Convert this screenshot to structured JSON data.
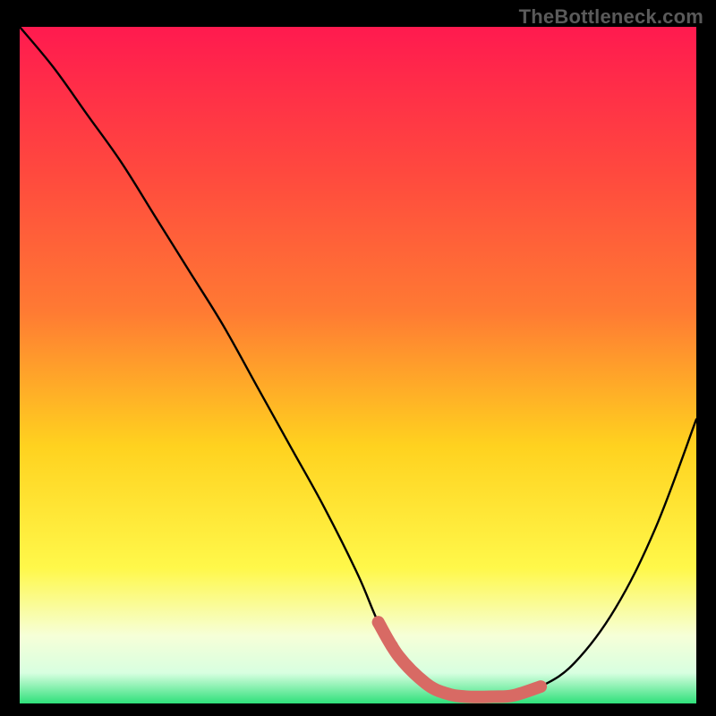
{
  "watermark": "TheBottleneck.com",
  "colors": {
    "frame_bg": "#000000",
    "gradient_top": "#ff1a4f",
    "gradient_mid_upper": "#ff7a33",
    "gradient_mid": "#ffd21f",
    "gradient_mid_lower": "#fff84a",
    "gradient_pale": "#f6ffd8",
    "gradient_bottom": "#2fe07a",
    "curve_stroke": "#000000",
    "highlight_stroke": "#d86a64"
  },
  "chart_data": {
    "type": "line",
    "title": "",
    "xlabel": "",
    "ylabel": "",
    "xlim": [
      0,
      100
    ],
    "ylim": [
      0,
      100
    ],
    "series": [
      {
        "name": "bottleneck-curve",
        "x": [
          0,
          5,
          10,
          15,
          20,
          25,
          30,
          35,
          40,
          45,
          50,
          53,
          56,
          60,
          63,
          66,
          70,
          73,
          77,
          82,
          88,
          94,
          100
        ],
        "y": [
          100,
          94,
          87,
          80,
          72,
          64,
          56,
          47,
          38,
          29,
          19,
          12,
          7,
          3,
          1.5,
          1,
          1,
          1.2,
          2.5,
          6,
          14,
          26,
          42
        ]
      }
    ],
    "highlight_segment": {
      "name": "optimal-range",
      "x": [
        53,
        56,
        60,
        63,
        66,
        70,
        73,
        77
      ],
      "y": [
        12,
        7,
        3,
        1.5,
        1,
        1,
        1.2,
        2.5
      ]
    }
  }
}
